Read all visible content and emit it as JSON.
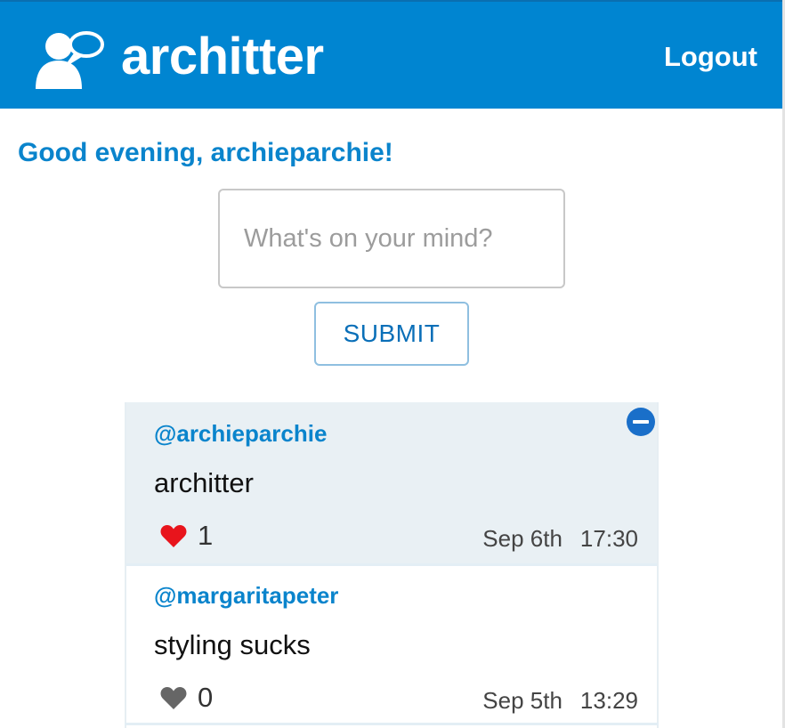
{
  "header": {
    "brand": "architter",
    "logout_label": "Logout",
    "background": "#0085d1"
  },
  "greeting": "Good evening, archieparchie!",
  "compose": {
    "placeholder": "What's on your mind?",
    "value": "",
    "submit_label": "SUBMIT"
  },
  "posts": [
    {
      "author": "@archieparchie",
      "text": "architter",
      "likes": "1",
      "liked": true,
      "date": "Sep 6th",
      "time": "17:30",
      "own": true
    },
    {
      "author": "@margaritapeter",
      "text": "styling sucks",
      "likes": "0",
      "liked": false,
      "date": "Sep 5th",
      "time": "13:29",
      "own": false
    }
  ],
  "colors": {
    "accent": "#0a84cc",
    "heart_liked": "#e8141c",
    "heart_unliked": "#666666",
    "own_post_bg": "#e9f0f4"
  },
  "icons": {
    "logo": "users-chat-icon",
    "delete": "minus-circle-icon",
    "like": "heart-icon"
  }
}
